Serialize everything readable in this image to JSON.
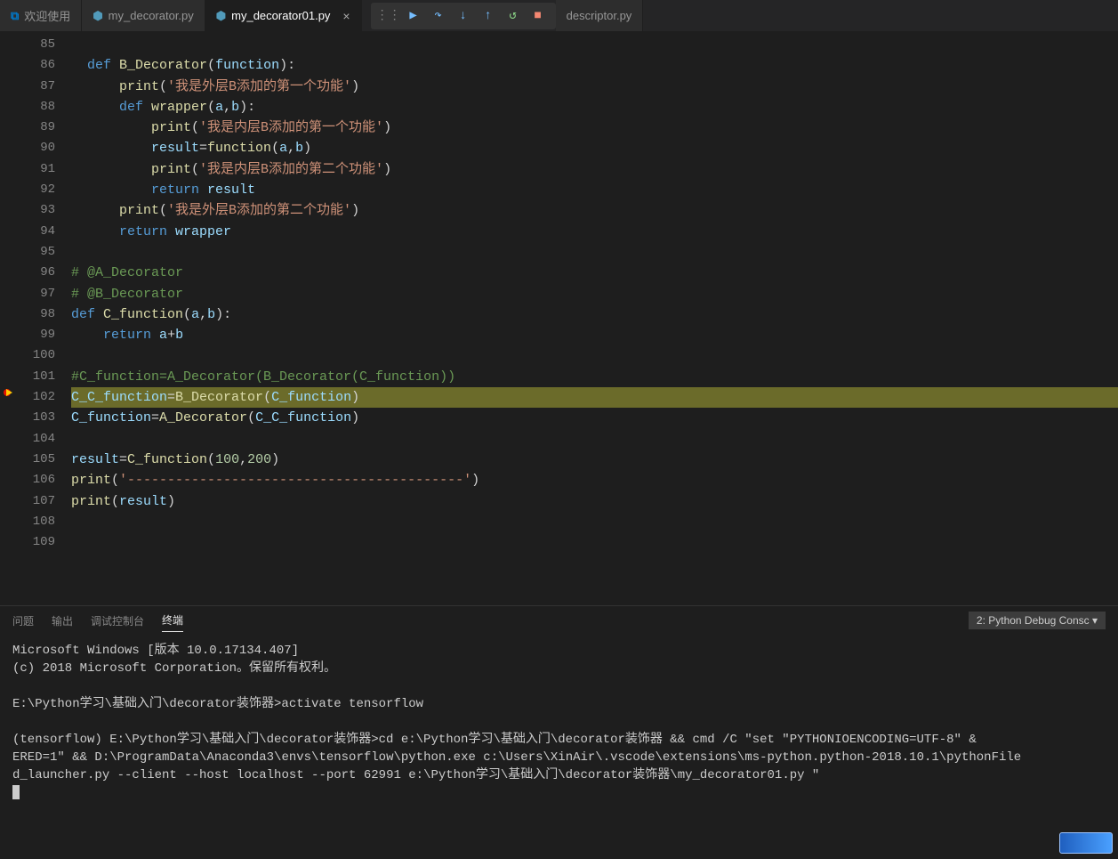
{
  "tabs": {
    "welcome": "欢迎使用",
    "file1": "my_decorator.py",
    "file2": "my_decorator01.py",
    "file3": "descriptor.py"
  },
  "panel": {
    "tab_problems": "问题",
    "tab_output": "输出",
    "tab_debug": "调试控制台",
    "tab_terminal": "终端",
    "select": "2: Python Debug Consc"
  },
  "lines": {
    "l85": "85",
    "l86": "86",
    "l87": "87",
    "l88": "88",
    "l89": "89",
    "l90": "90",
    "l91": "91",
    "l92": "92",
    "l93": "93",
    "l94": "94",
    "l95": "95",
    "l96": "96",
    "l97": "97",
    "l98": "98",
    "l99": "99",
    "l100": "100",
    "l101": "101",
    "l102": "102",
    "l103": "103",
    "l104": "104",
    "l105": "105",
    "l106": "106",
    "l107": "107",
    "l108": "108",
    "l109": "109"
  },
  "code": {
    "def": "def",
    "return": "return",
    "B_Decorator": "B_Decorator",
    "A_Decorator": "A_Decorator",
    "function": "function",
    "wrapper": "wrapper",
    "print": "print",
    "result": "result",
    "a": "a",
    "b": "b",
    "s_outerB1": "'我是外层B添加的第一个功能'",
    "s_innerB1": "'我是内层B添加的第一个功能'",
    "s_innerB2": "'我是内层B添加的第二个功能'",
    "s_outerB2": "'我是外层B添加的第二个功能'",
    "cmt_A": "# @A_Decorator",
    "cmt_B": "# @B_Decorator",
    "C_function": "C_function",
    "C_C_function": "C_C_function",
    "cmt_line101": "#C_function=A_Decorator(B_Decorator(C_function))",
    "n100": "100",
    "n200": "200",
    "sep": "'------------------------------------------'"
  },
  "terminal": {
    "l1": "Microsoft Windows [版本 10.0.17134.407]",
    "l2": "(c) 2018 Microsoft Corporation。保留所有权利。",
    "l3": "E:\\Python学习\\基础入门\\decorator装饰器>activate tensorflow",
    "l4": "(tensorflow) E:\\Python学习\\基础入门\\decorator装饰器>cd e:\\Python学习\\基础入门\\decorator装饰器 && cmd /C \"set \"PYTHONIOENCODING=UTF-8\" &",
    "l5": "ERED=1\" && D:\\ProgramData\\Anaconda3\\envs\\tensorflow\\python.exe c:\\Users\\XinAir\\.vscode\\extensions\\ms-python.python-2018.10.1\\pythonFile",
    "l6": "d_launcher.py --client --host localhost --port 62991 e:\\Python学习\\基础入门\\decorator装饰器\\my_decorator01.py \""
  }
}
